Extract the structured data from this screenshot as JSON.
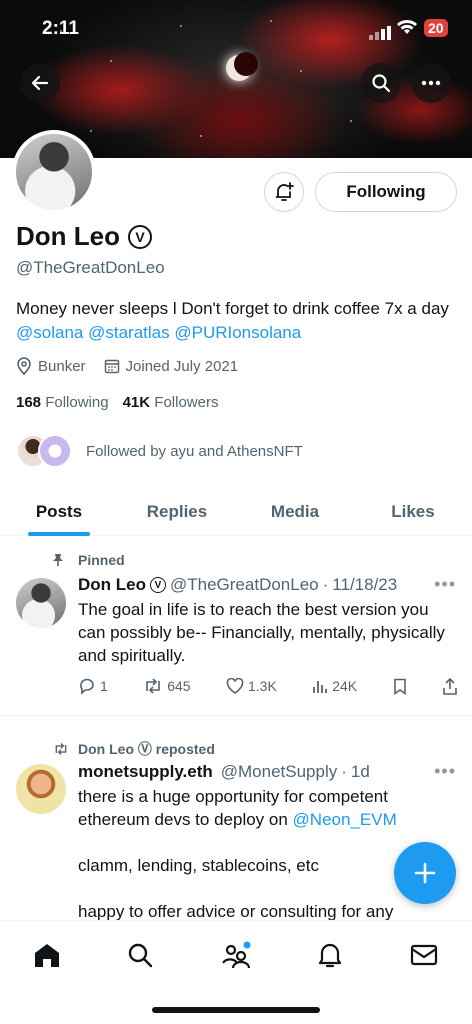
{
  "status_bar": {
    "time": "2:11",
    "battery": "20"
  },
  "profile": {
    "name": "Don Leo",
    "verified_glyph": "Ⓥ",
    "handle": "@TheGreatDonLeo",
    "bio_text": "Money never sleeps l Don't forget to drink coffee 7x a day",
    "bio_mentions": [
      "@solana",
      "@staratlas",
      "@PURIonsolana"
    ],
    "location": "Bunker",
    "joined": "Joined July 2021",
    "following_count": "168",
    "following_label": "Following",
    "followers_count": "41K",
    "followers_label": "Followers",
    "followed_by": "Followed by ayu and AthensNFT",
    "follow_button_label": "Following"
  },
  "tabs": [
    {
      "label": "Posts",
      "active": true
    },
    {
      "label": "Replies",
      "active": false
    },
    {
      "label": "Media",
      "active": false
    },
    {
      "label": "Likes",
      "active": false
    }
  ],
  "posts": [
    {
      "context": "Pinned",
      "author_name": "Don Leo",
      "author_handle": "@TheGreatDonLeo",
      "date": "11/18/23",
      "text": "The goal in life is to reach the best version you can possibly be-- Financially, mentally, physically and spiritually.",
      "replies": "1",
      "reposts": "645",
      "likes": "1.3K",
      "views": "24K"
    },
    {
      "context": "Don Leo Ⓥ reposted",
      "author_name": "monetsupply.eth",
      "author_handle": "@MonetSupply",
      "date": "1d",
      "text_line1": "there is a huge opportunity for competent ethereum devs to deploy on",
      "text_mention": "@Neon_EVM",
      "text_line2": "clamm, lending, stablecoins, etc",
      "text_line3": "happy to offer advice or consulting for any"
    }
  ],
  "colors": {
    "accent": "#1d9bf0",
    "text": "#0f1419",
    "muted": "#536471"
  }
}
